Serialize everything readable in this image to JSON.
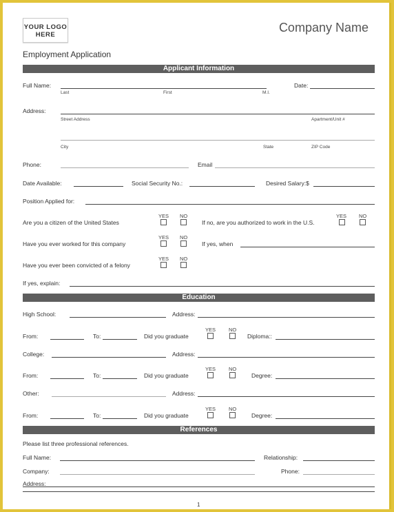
{
  "header": {
    "logo_line1": "YOUR LOGO",
    "logo_line2": "HERE",
    "company_name": "Company Name",
    "form_title": "Employment Application"
  },
  "sections": {
    "applicant": "Applicant Information",
    "education": "Education",
    "references": "References"
  },
  "applicant": {
    "full_name": "Full Name:",
    "last": "Last",
    "first": "First",
    "mi": "M.I.",
    "date": "Date:",
    "address": "Address:",
    "street": "Street Address",
    "apt": "Apartment/Unit #",
    "city": "City",
    "state": "State",
    "zip": "ZIP Code",
    "phone": "Phone:",
    "email": "Email",
    "date_available": "Date Available:",
    "ssn": "Social Security No.:",
    "salary": "Desired Salary:$",
    "position": "Position Applied for:",
    "q_citizen": "Are you a citizen of the United States",
    "q_authorized": "If no, are you authorized to work in the U.S.",
    "q_worked": "Have you ever worked for this company",
    "q_when": "If yes, when",
    "q_felony": "Have you ever been convicted of a felony",
    "explain": "If yes, explain:"
  },
  "yes": "YES",
  "no": "NO",
  "education": {
    "high_school": "High School:",
    "college": "College:",
    "other": "Other:",
    "address": "Address:",
    "from": "From:",
    "to": "To:",
    "graduate": "Did you graduate",
    "diploma": "Diploma::",
    "degree": "Degree:"
  },
  "references": {
    "intro": "Please list three professional references.",
    "full_name": "Full Name:",
    "relationship": "Relationship:",
    "company": "Company:",
    "phone": "Phone:",
    "address": "Address:"
  },
  "page_number": "1"
}
